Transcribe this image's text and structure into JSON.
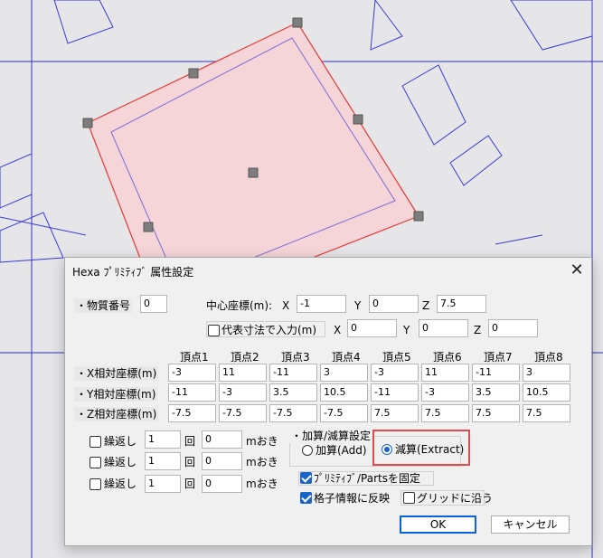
{
  "dialog": {
    "title": "Hexa ﾌﾟﾘﾐﾃｨﾌﾞ 属性設定",
    "close_glyph": "✕",
    "material_label": "・物質番号",
    "material_value": "0",
    "center_label": "中心座標(m):",
    "center": {
      "x_label": "X",
      "x": "-1",
      "y_label": "Y",
      "y": "0",
      "z_label": "Z",
      "z": "7.5"
    },
    "rep_label": "代表寸法で入力(m)",
    "rep": {
      "x_label": "X",
      "x": "0",
      "y_label": "Y",
      "y": "0",
      "z_label": "Z",
      "z": "0"
    },
    "vertex_headers": [
      "頂点1",
      "頂点2",
      "頂点3",
      "頂点4",
      "頂点5",
      "頂点6",
      "頂点7",
      "頂点8"
    ],
    "rows": [
      {
        "label": "・X相対座標(m)",
        "values": [
          "-3",
          "11",
          "-11",
          "3",
          "-3",
          "11",
          "-11",
          "3"
        ]
      },
      {
        "label": "・Y相対座標(m)",
        "values": [
          "-11",
          "-3",
          "3.5",
          "10.5",
          "-11",
          "-3",
          "3.5",
          "10.5"
        ]
      },
      {
        "label": "・Z相対座標(m)",
        "values": [
          "-7.5",
          "-7.5",
          "-7.5",
          "-7.5",
          "7.5",
          "7.5",
          "7.5",
          "7.5"
        ]
      }
    ],
    "repeats": [
      {
        "label": "繰返し",
        "count": "1",
        "icon": "回",
        "interval": "0",
        "unit": "mおき"
      },
      {
        "label": "繰返し",
        "count": "1",
        "icon": "回",
        "interval": "0",
        "unit": "mおき"
      },
      {
        "label": "繰返し",
        "count": "1",
        "icon": "回",
        "interval": "0",
        "unit": "mおき"
      }
    ],
    "addsub_label": "・加算/減算設定",
    "add_label": "加算(Add)",
    "extract_label": "減算(Extract)",
    "fix_parts_label": "ﾌﾟﾘﾐﾃｨﾌﾞ/Partsを固定",
    "grid_reflect_label": "格子情報に反映",
    "grid_follow_label": "グリッドに沿う",
    "ok_label": "OK",
    "cancel_label": "キャンセル"
  },
  "colors": {
    "shape_fill": "#f5d5d8",
    "shape_stroke": "#e53935",
    "line": "#3b3bd6",
    "highlight": "#e5484d",
    "accent": "#1a64c8"
  }
}
